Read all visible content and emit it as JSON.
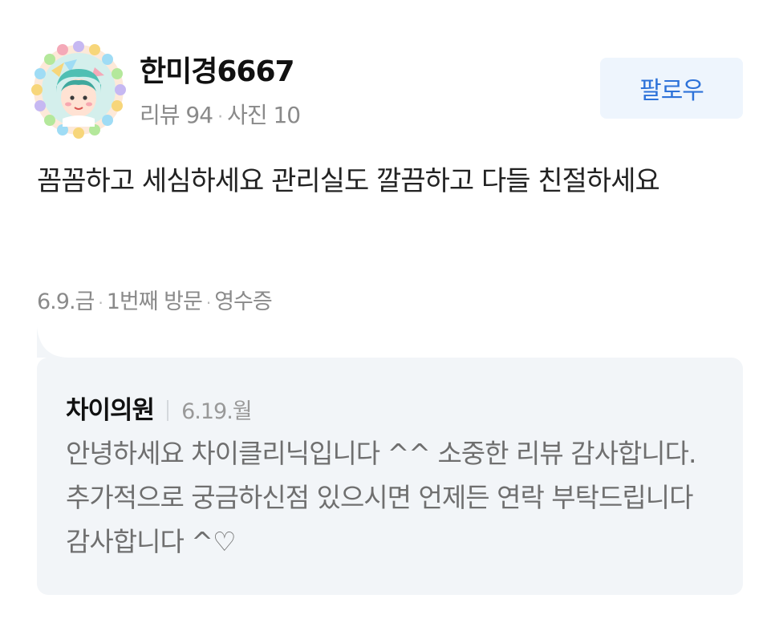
{
  "profile": {
    "name": "한미경6667",
    "reviews_label": "리뷰 94",
    "photos_label": "사진 10"
  },
  "follow_button": {
    "label": "팔로우"
  },
  "review": {
    "text": "꼼꼼하고 세심하세요 관리실도 깔끔하고 다들 친절하세요",
    "date": "6.9.금",
    "visit": "1번째 방문",
    "receipt": "영수증"
  },
  "reply": {
    "owner": "차이의원",
    "date": "6.19.월",
    "text": "안녕하세요 차이클리닉입니다 ^^ 소중한 리뷰 감사합니다. 추가적으로 궁금하신점 있으시면 언제든 연락 부탁드립니다 감사합니다 ^♡"
  },
  "colors": {
    "follow_bg": "#eef5fd",
    "follow_text": "#2d72d9",
    "reply_bg": "#f2f5f8"
  }
}
